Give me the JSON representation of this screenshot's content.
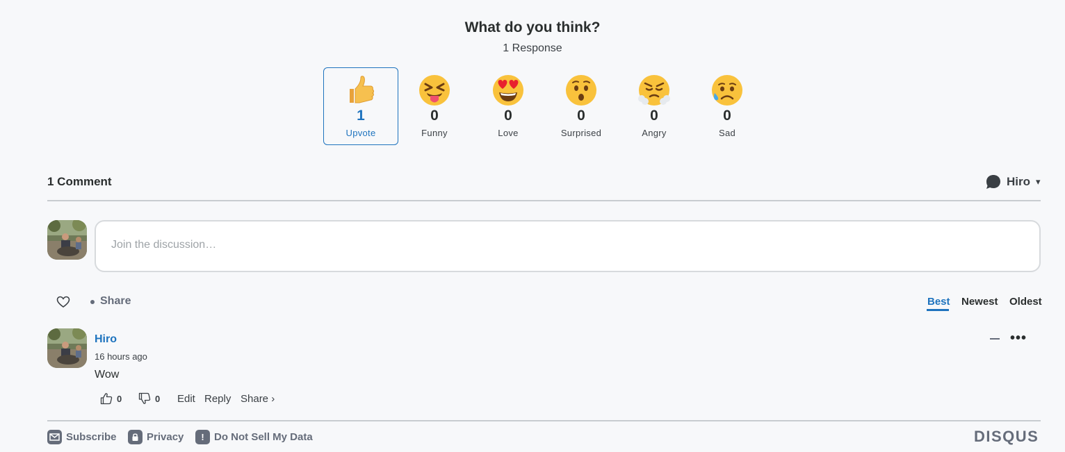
{
  "header": {
    "title": "What do you think?",
    "subtitle": "1 Response"
  },
  "reactions": [
    {
      "label": "Upvote",
      "count": "1",
      "icon": "thumbs-up-icon",
      "selected": true
    },
    {
      "label": "Funny",
      "count": "0",
      "icon": "tongue-out-emoji-icon"
    },
    {
      "label": "Love",
      "count": "0",
      "icon": "heart-eyes-emoji-icon"
    },
    {
      "label": "Surprised",
      "count": "0",
      "icon": "surprised-emoji-icon"
    },
    {
      "label": "Angry",
      "count": "0",
      "icon": "steam-angry-emoji-icon"
    },
    {
      "label": "Sad",
      "count": "0",
      "icon": "sad-sweat-emoji-icon"
    }
  ],
  "comments_header": {
    "count_label": "1 Comment",
    "user_name": "Hiro",
    "caret": "▾"
  },
  "compose": {
    "placeholder": "Join the discussion…"
  },
  "toolbar": {
    "share_label": "Share",
    "sort": {
      "best": "Best",
      "newest": "Newest",
      "oldest": "Oldest",
      "active": "Best"
    }
  },
  "comment": {
    "author": "Hiro",
    "time": "16 hours ago",
    "body": "Wow",
    "upvotes": "0",
    "downvotes": "0",
    "actions": {
      "edit": "Edit",
      "reply": "Reply",
      "share": "Share ›"
    },
    "more": "•••"
  },
  "footer": {
    "subscribe": "Subscribe",
    "privacy": "Privacy",
    "do_not_sell": "Do Not Sell My Data",
    "brand": "DISQUS"
  },
  "colors": {
    "accent": "#1e73be",
    "muted": "#656c7a",
    "background": "#f7f8fa"
  }
}
